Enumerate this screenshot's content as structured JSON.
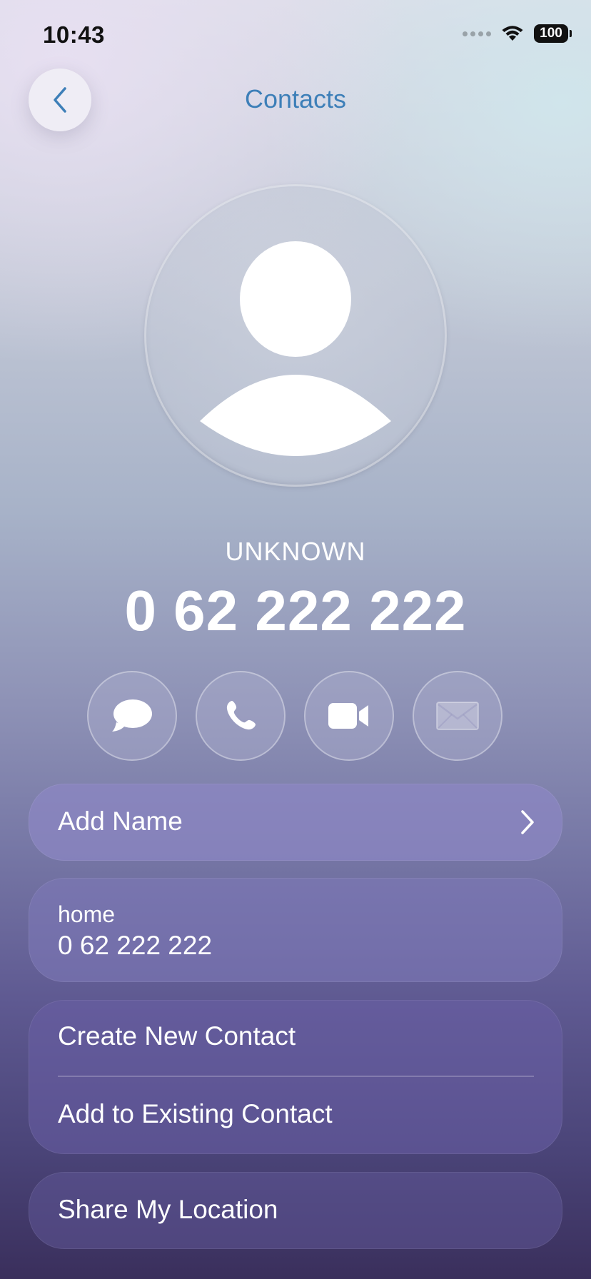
{
  "status_bar": {
    "time": "10:43",
    "battery": "100"
  },
  "nav": {
    "title": "Contacts"
  },
  "caller": {
    "label": "UNKNOWN",
    "number": "0 62 222 222"
  },
  "actions": [
    "message-icon",
    "phone-icon",
    "video-icon",
    "mail-icon"
  ],
  "add_name": {
    "label": "Add Name"
  },
  "phone_entry": {
    "label": "home",
    "number": "0 62 222 222"
  },
  "contact_actions": {
    "create": "Create New Contact",
    "add_existing": "Add to Existing Contact"
  },
  "share_location": {
    "label": "Share My Location"
  },
  "colors": {
    "accent": "#3d7fb8"
  }
}
